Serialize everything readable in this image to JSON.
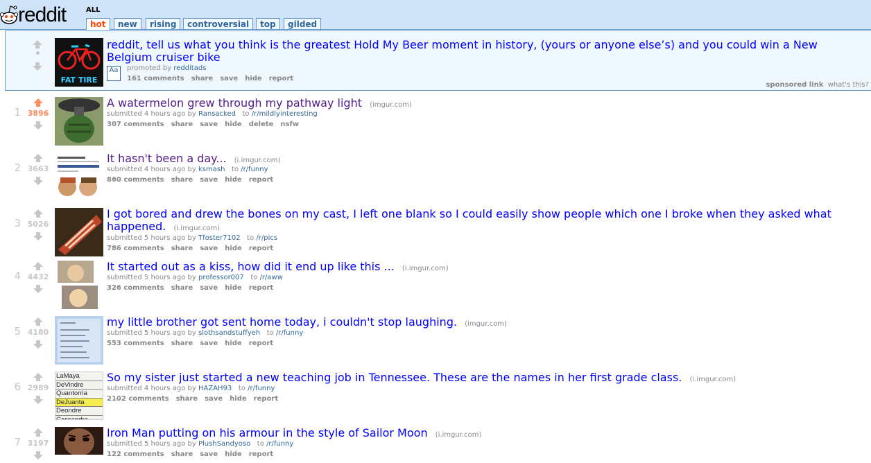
{
  "header": {
    "logo": "reddit",
    "subreddit": "ALL",
    "tabs": [
      "hot",
      "new",
      "rising",
      "controversial",
      "top",
      "gilded"
    ],
    "selected_tab": "hot"
  },
  "promoted": {
    "title": "reddit, tell us what you think is the greatest Hold My Beer moment in history, (yours or anyone else’s) and you could win a New Belgium cruiser bike",
    "promoted_prefix": "promoted by",
    "promoted_by": "redditads",
    "comments": "161 comments",
    "actions": [
      "share",
      "save",
      "hide",
      "report"
    ],
    "sponsored": "sponsored link",
    "whats_this": "what's this?",
    "thumb_text": "FAT TIRE",
    "aa_icon": "Aa"
  },
  "posts": [
    {
      "rank": "1",
      "score": "3896",
      "title": "A watermelon grew through my pathway light",
      "domain": "(imgur.com)",
      "submitted": "submitted 4 hours ago by",
      "author": "Ransacked",
      "to": "to",
      "sub": "/r/mildlyinteresting",
      "comments": "307 comments",
      "actions": [
        "share",
        "save",
        "hide",
        "delete",
        "nsfw"
      ]
    },
    {
      "rank": "2",
      "score": "3663",
      "title": "It hasn't been a day...",
      "domain": "(i.imgur.com)",
      "submitted": "submitted 4 hours ago by",
      "author": "ksmash",
      "to": "to",
      "sub": "/r/funny",
      "comments": "860 comments",
      "actions": [
        "share",
        "save",
        "hide",
        "report"
      ]
    },
    {
      "rank": "3",
      "score": "5026",
      "title": "I got bored and drew the bones on my cast, I left one blank so I could easily show people which one I broke when they asked what happened.",
      "domain": "(i.imgur.com)",
      "submitted": "submitted 5 hours ago by",
      "author": "Tfoster7102",
      "to": "to",
      "sub": "/r/pics",
      "comments": "786 comments",
      "actions": [
        "share",
        "save",
        "hide",
        "report"
      ]
    },
    {
      "rank": "4",
      "score": "4432",
      "title": "It started out as a kiss, how did it end up like this ...",
      "domain": "(i.imgur.com)",
      "submitted": "submitted 5 hours ago by",
      "author": "professor007",
      "to": "to",
      "sub": "/r/aww",
      "comments": "326 comments",
      "actions": [
        "share",
        "save",
        "hide",
        "report"
      ]
    },
    {
      "rank": "5",
      "score": "4180",
      "title": "my little brother got sent home today, i couldn't stop laughing.",
      "domain": "(imgur.com)",
      "submitted": "submitted 5 hours ago by",
      "author": "slothsandstuffyeh",
      "to": "to",
      "sub": "/r/funny",
      "comments": "553 comments",
      "actions": [
        "share",
        "save",
        "hide",
        "report"
      ]
    },
    {
      "rank": "6",
      "score": "2989",
      "title": "So my sister just started a new teaching job in Tennessee. These are the names in her first grade class.",
      "domain": "(i.imgur.com)",
      "submitted": "submitted 4 hours ago by",
      "author": "HAZAH93",
      "to": "to",
      "sub": "/r/funny",
      "comments": "2102 comments",
      "actions": [
        "share",
        "save",
        "hide",
        "report"
      ],
      "thumb_names": [
        "LaMaya",
        "DeVindre",
        "Quantorria",
        "DeJuanta",
        "Deondre",
        "Cassandra"
      ]
    },
    {
      "rank": "7",
      "score": "3197",
      "title": "Iron Man putting on his armour in the style of Sailor Moon",
      "domain": "(i.imgur.com)",
      "submitted": "submitted 5 hours ago by",
      "author": "PlushSandyoso",
      "to": "to",
      "sub": "/r/funny",
      "comments": "122 comments",
      "actions": [
        "share",
        "save",
        "hide",
        "report"
      ]
    }
  ]
}
